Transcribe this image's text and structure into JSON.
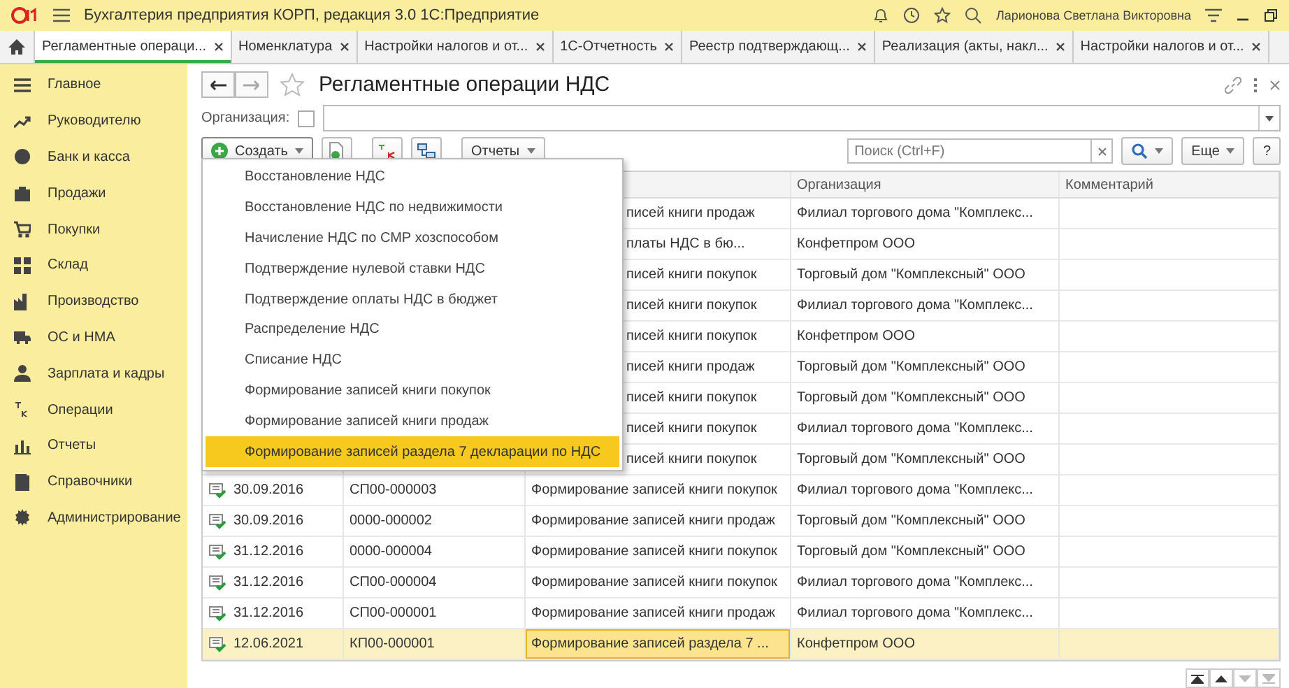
{
  "app_title": "Бухгалтерия предприятия КОРП, редакция 3.0 1С:Предприятие",
  "user": "Ларионова Светлана Викторовна",
  "tabs": [
    {
      "label": "Регламентные операци...",
      "selected": true
    },
    {
      "label": "Номенклатура",
      "selected": false
    },
    {
      "label": "Настройки налогов и от...",
      "selected": false
    },
    {
      "label": "1С-Отчетность",
      "selected": false
    },
    {
      "label": "Реестр подтверждающ...",
      "selected": false
    },
    {
      "label": "Реализация (акты, накл...",
      "selected": false
    },
    {
      "label": "Настройки налогов и от...",
      "selected": false
    }
  ],
  "sidebar": {
    "items": [
      {
        "label": "Главное"
      },
      {
        "label": "Руководителю"
      },
      {
        "label": "Банк и касса"
      },
      {
        "label": "Продажи"
      },
      {
        "label": "Покупки"
      },
      {
        "label": "Склад"
      },
      {
        "label": "Производство"
      },
      {
        "label": "ОС и НМА"
      },
      {
        "label": "Зарплата и кадры"
      },
      {
        "label": "Операции"
      },
      {
        "label": "Отчеты"
      },
      {
        "label": "Справочники"
      },
      {
        "label": "Администрирование"
      }
    ]
  },
  "form": {
    "title": "Регламентные операции НДС",
    "filter_label": "Организация:",
    "filter_checked": false,
    "toolbar": {
      "create": "Создать",
      "reports": "Отчеты",
      "search_placeholder": "Поиск (Ctrl+F)",
      "more": "Еще",
      "help": "?"
    },
    "menu": [
      {
        "label": "Восстановление НДС",
        "selected": false
      },
      {
        "label": "Восстановление НДС по недвижимости",
        "selected": false
      },
      {
        "label": "Начисление НДС по СМР хозспособом",
        "selected": false
      },
      {
        "label": "Подтверждение нулевой ставки НДС",
        "selected": false
      },
      {
        "label": "Подтверждение оплаты НДС в бюджет",
        "selected": false
      },
      {
        "label": "Распределение НДС",
        "selected": false
      },
      {
        "label": "Списание НДС",
        "selected": false
      },
      {
        "label": "Формирование записей книги покупок",
        "selected": false
      },
      {
        "label": "Формирование записей книги продаж",
        "selected": false
      },
      {
        "label": "Формирование записей раздела 7 декларации по НДС",
        "selected": true
      }
    ],
    "table": {
      "columns": [
        {
          "label": "Организация"
        },
        {
          "label": "Комментарий"
        }
      ],
      "rows": [
        {
          "operation": "писей книги продаж",
          "organization": "Филиал торгового дома \"Комплекс...",
          "selected": false
        },
        {
          "operation": "платы НДС в бю...",
          "organization": "Конфетпром ООО",
          "selected": false
        },
        {
          "operation": "писей книги покупок",
          "organization": "Торговый дом \"Комплексный\" ООО",
          "selected": false
        },
        {
          "operation": "писей книги покупок",
          "organization": "Филиал торгового дома \"Комплекс...",
          "selected": false
        },
        {
          "operation": "писей книги покупок",
          "organization": "Конфетпром ООО",
          "selected": false
        },
        {
          "operation": "писей книги продаж",
          "organization": "Торговый дом \"Комплексный\" ООО",
          "selected": false
        },
        {
          "operation": "писей книги покупок",
          "organization": "Торговый дом \"Комплексный\" ООО",
          "selected": false
        },
        {
          "operation": "писей книги покупок",
          "organization": "Филиал торгового дома \"Комплекс...",
          "selected": false
        },
        {
          "operation": "писей книги покупок",
          "organization": "Торговый дом \"Комплексный\" ООО",
          "selected": false
        },
        {
          "date": "30.09.2016",
          "number": "СП00-000003",
          "operation": "Формирование записей книги покупок",
          "organization": "Филиал торгового дома \"Комплекс...",
          "selected": false
        },
        {
          "date": "30.09.2016",
          "number": "0000-000002",
          "operation": "Формирование записей книги продаж",
          "organization": "Торговый дом \"Комплексный\" ООО",
          "selected": false
        },
        {
          "date": "31.12.2016",
          "number": "0000-000004",
          "operation": "Формирование записей книги покупок",
          "organization": "Торговый дом \"Комплексный\" ООО",
          "selected": false
        },
        {
          "date": "31.12.2016",
          "number": "СП00-000004",
          "operation": "Формирование записей книги покупок",
          "organization": "Филиал торгового дома \"Комплекс...",
          "selected": false
        },
        {
          "date": "31.12.2016",
          "number": "СП00-000001",
          "operation": "Формирование записей книги продаж",
          "organization": "Филиал торгового дома \"Комплекс...",
          "selected": false
        },
        {
          "date": "12.06.2021",
          "number": "КП00-000001",
          "operation": "Формирование записей раздела 7 ...",
          "organization": "Конфетпром ООО",
          "selected": true
        }
      ]
    }
  }
}
